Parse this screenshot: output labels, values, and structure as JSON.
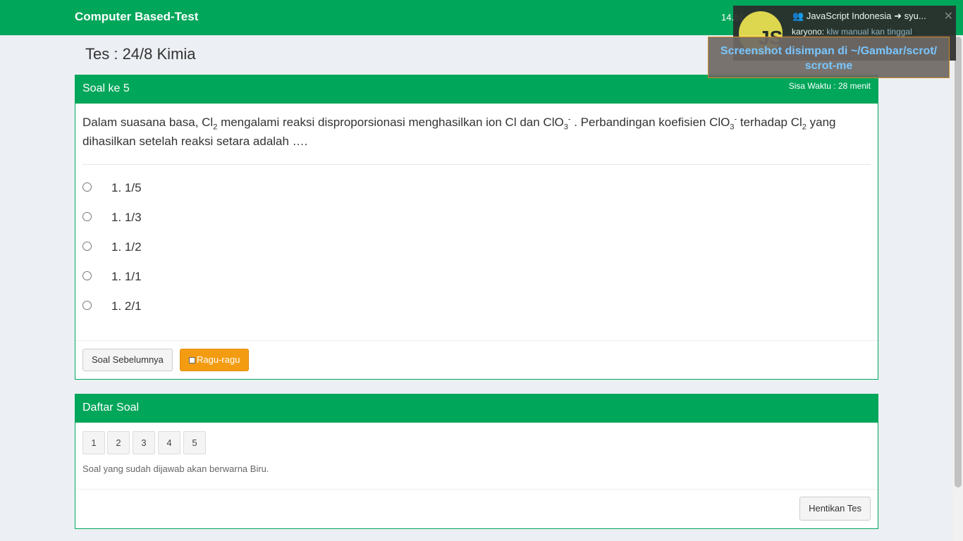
{
  "navbar": {
    "brand": "Computer Based-Test",
    "clock": "14.51"
  },
  "page": {
    "title": "Tes : 24/8 Kimia"
  },
  "question_panel": {
    "heading": "Soal ke 5",
    "timer": "Sisa Waktu : 28 menit",
    "question": {
      "p1": "Dalam suasana basa, Cl",
      "p2": "2",
      "p3": " mengalami reaksi disproporsionasi menghasilkan ion Cl dan ClO",
      "p4": "3",
      "p5": "-",
      "p6": " . Perbandingan koefisien ClO",
      "p7": "3",
      "p8": "-",
      "p9": " terhadap Cl",
      "p10": "2",
      "p11": " yang dihasilkan setelah reaksi setara adalah …."
    },
    "options": [
      "1. 1/5",
      "1. 1/3",
      "1. 1/2",
      "1. 1/1",
      "1. 2/1"
    ],
    "prev_button": "Soal Sebelumnya",
    "doubt_button": "Ragu-ragu"
  },
  "list_panel": {
    "heading": "Daftar Soal",
    "numbers": [
      "1",
      "2",
      "3",
      "4",
      "5"
    ],
    "hint": "Soal yang sudah dijawab akan berwarna Biru.",
    "stop_button": "Hentikan Tes"
  },
  "notification": {
    "title": "JavaScript Indonesia ➜ syu...",
    "sender": "karyono:",
    "message": "klw manual kan tinggal",
    "avatar_text": "JS"
  },
  "toast": {
    "line1": "Screenshot disimpan di ~/Gambar/scrot/",
    "line2": "scrot-me"
  },
  "colors": {
    "primary": "#00a65a",
    "warning": "#f39c12",
    "background": "#eceff3"
  }
}
